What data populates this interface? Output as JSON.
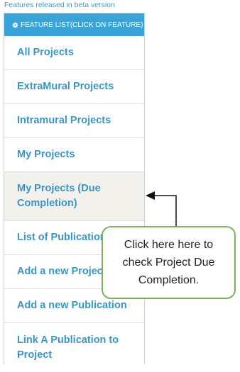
{
  "beta_note": "Features released in beta version",
  "panel": {
    "header": "FEATURE LIST(CLICK ON FEATURE)",
    "header_icon": "gear-icon",
    "items": [
      {
        "label": "All Projects"
      },
      {
        "label": "ExtraMural Projects"
      },
      {
        "label": "Intramural Projects"
      },
      {
        "label": "My Projects"
      },
      {
        "label": "My Projects (Due Completion)",
        "line1": "My Projects (Due",
        "line2": "Completion)",
        "active": true
      },
      {
        "label": "List of Publications"
      },
      {
        "label": "Add a new Project"
      },
      {
        "label": "Add a new Publication"
      },
      {
        "label": "Link A Publication to Project",
        "line1": "Link A Publication to",
        "line2": "Project"
      }
    ]
  },
  "callout": {
    "line1": "Click here here to",
    "line2": "check Project Due",
    "line3": "Completion."
  },
  "colors": {
    "header_bg": "#3aa3d8",
    "link": "#3a95c8",
    "callout_border": "#7fb25a"
  }
}
